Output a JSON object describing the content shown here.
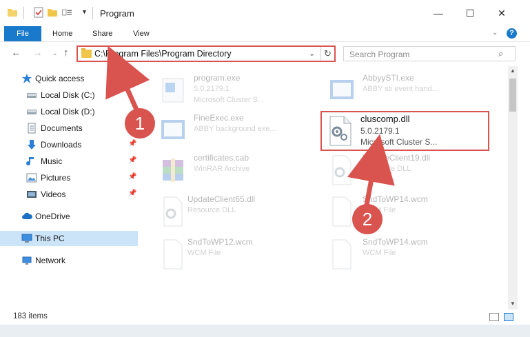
{
  "window": {
    "title": "Program",
    "minimize": "—",
    "maximize": "☐",
    "close": "✕"
  },
  "ribbon": {
    "tabs": [
      "File",
      "Home",
      "Share",
      "View"
    ],
    "expand": "⌄",
    "help": "?"
  },
  "navigation": {
    "back": "←",
    "forward": "→",
    "recent": "⌄",
    "up": "↑"
  },
  "address": {
    "path": "C:\\Program Files\\Program Directory",
    "dropdown": "⌄",
    "refresh": "↻"
  },
  "search": {
    "placeholder": "Search Program",
    "icon": "⌕"
  },
  "sidebar": {
    "items": [
      {
        "label": "Quick access",
        "icon": "star-icon",
        "pinned": false
      },
      {
        "label": "Local Disk (C:)",
        "icon": "drive-icon",
        "pinned": false
      },
      {
        "label": "Local Disk (D:)",
        "icon": "drive-icon",
        "pinned": false
      },
      {
        "label": "Documents",
        "icon": "documents-icon",
        "pinned": false
      },
      {
        "label": "Downloads",
        "icon": "download-icon",
        "pinned": true
      },
      {
        "label": "Music",
        "icon": "music-icon",
        "pinned": true
      },
      {
        "label": "Pictures",
        "icon": "pictures-icon",
        "pinned": true
      },
      {
        "label": "Videos",
        "icon": "videos-icon",
        "pinned": true
      },
      {
        "label": "OneDrive",
        "icon": "cloud-icon",
        "pinned": false
      },
      {
        "label": "This PC",
        "icon": "computer-icon",
        "pinned": false,
        "selected": true
      },
      {
        "label": "Network",
        "icon": "network-icon",
        "pinned": false
      }
    ],
    "pin_glyph": "📌"
  },
  "files": [
    {
      "name": "program.exe",
      "line1": "5.0.2179.1",
      "line2": "Microsoft Cluster S...",
      "icon": "exe-icon",
      "dimmed": true
    },
    {
      "name": "AbbyySTI.exe",
      "line1": "ABBY sti event hand...",
      "line2": "",
      "icon": "exe-icon",
      "dimmed": true
    },
    {
      "name": "FineExec.exe",
      "line1": "ABBY background exe...",
      "line2": "",
      "icon": "exe-icon",
      "dimmed": true
    },
    {
      "name": "certificates.cab",
      "line1": "WinRAR Archive",
      "line2": "",
      "icon": "archive-icon",
      "dimmed": true
    },
    {
      "name": "UpdateClient19.dll",
      "line1": "Resource DLL",
      "line2": "",
      "icon": "dll-icon",
      "dimmed": true
    },
    {
      "name": "UpdateClient65.dll",
      "line1": "Resource DLL",
      "line2": "",
      "icon": "dll-icon",
      "dimmed": true
    },
    {
      "name": "SndToWP14.wcm",
      "line1": "WCM File",
      "line2": "",
      "icon": "file-icon",
      "dimmed": true
    },
    {
      "name": "SndToWP12.wcm",
      "line1": "WCM File",
      "line2": "",
      "icon": "file-icon",
      "dimmed": true
    },
    {
      "name": "SndToWP14.wcm",
      "line1": "WCM File",
      "line2": "",
      "icon": "file-icon",
      "dimmed": true
    }
  ],
  "highlighted_file": {
    "name": "cluscomp.dll",
    "line1": "5.0.2179.1",
    "line2": "Microsoft Cluster S...",
    "icon": "dll-gear-icon"
  },
  "status": {
    "items_count": "183 items"
  },
  "annotations": {
    "step1": "1",
    "step2": "2",
    "color": "#d9534f"
  },
  "colors": {
    "accent": "#1979ca",
    "selection": "#cce4f7",
    "highlight_red": "#d9534f"
  }
}
